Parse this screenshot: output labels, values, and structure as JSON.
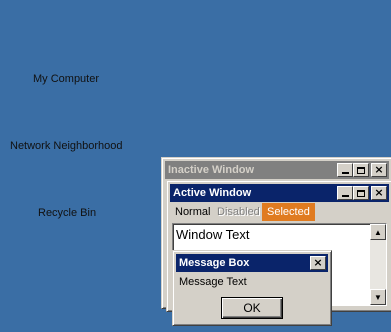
{
  "desktop": {
    "icons": [
      {
        "label": "My Computer"
      },
      {
        "label": "Network Neighborhood"
      },
      {
        "label": "Recycle Bin"
      }
    ]
  },
  "inactive_window": {
    "title": "Inactive Window"
  },
  "active_window": {
    "title": "Active Window",
    "menu": {
      "normal": "Normal",
      "disabled": "Disabled",
      "selected": "Selected"
    },
    "window_text": "Window Text"
  },
  "message_box": {
    "title": "Message Box",
    "text": "Message Text",
    "ok_label": "OK"
  },
  "colors": {
    "desktop": "#3a6ea5",
    "active_title": "#0a246a",
    "inactive_title": "#808080",
    "selected_menu": "#e07b20"
  },
  "icons": {
    "minimize": "minimize-icon",
    "maximize": "maximize-icon",
    "close": "close-icon",
    "scroll_up": "scroll-up-arrow-icon",
    "scroll_down": "scroll-down-arrow-icon"
  }
}
